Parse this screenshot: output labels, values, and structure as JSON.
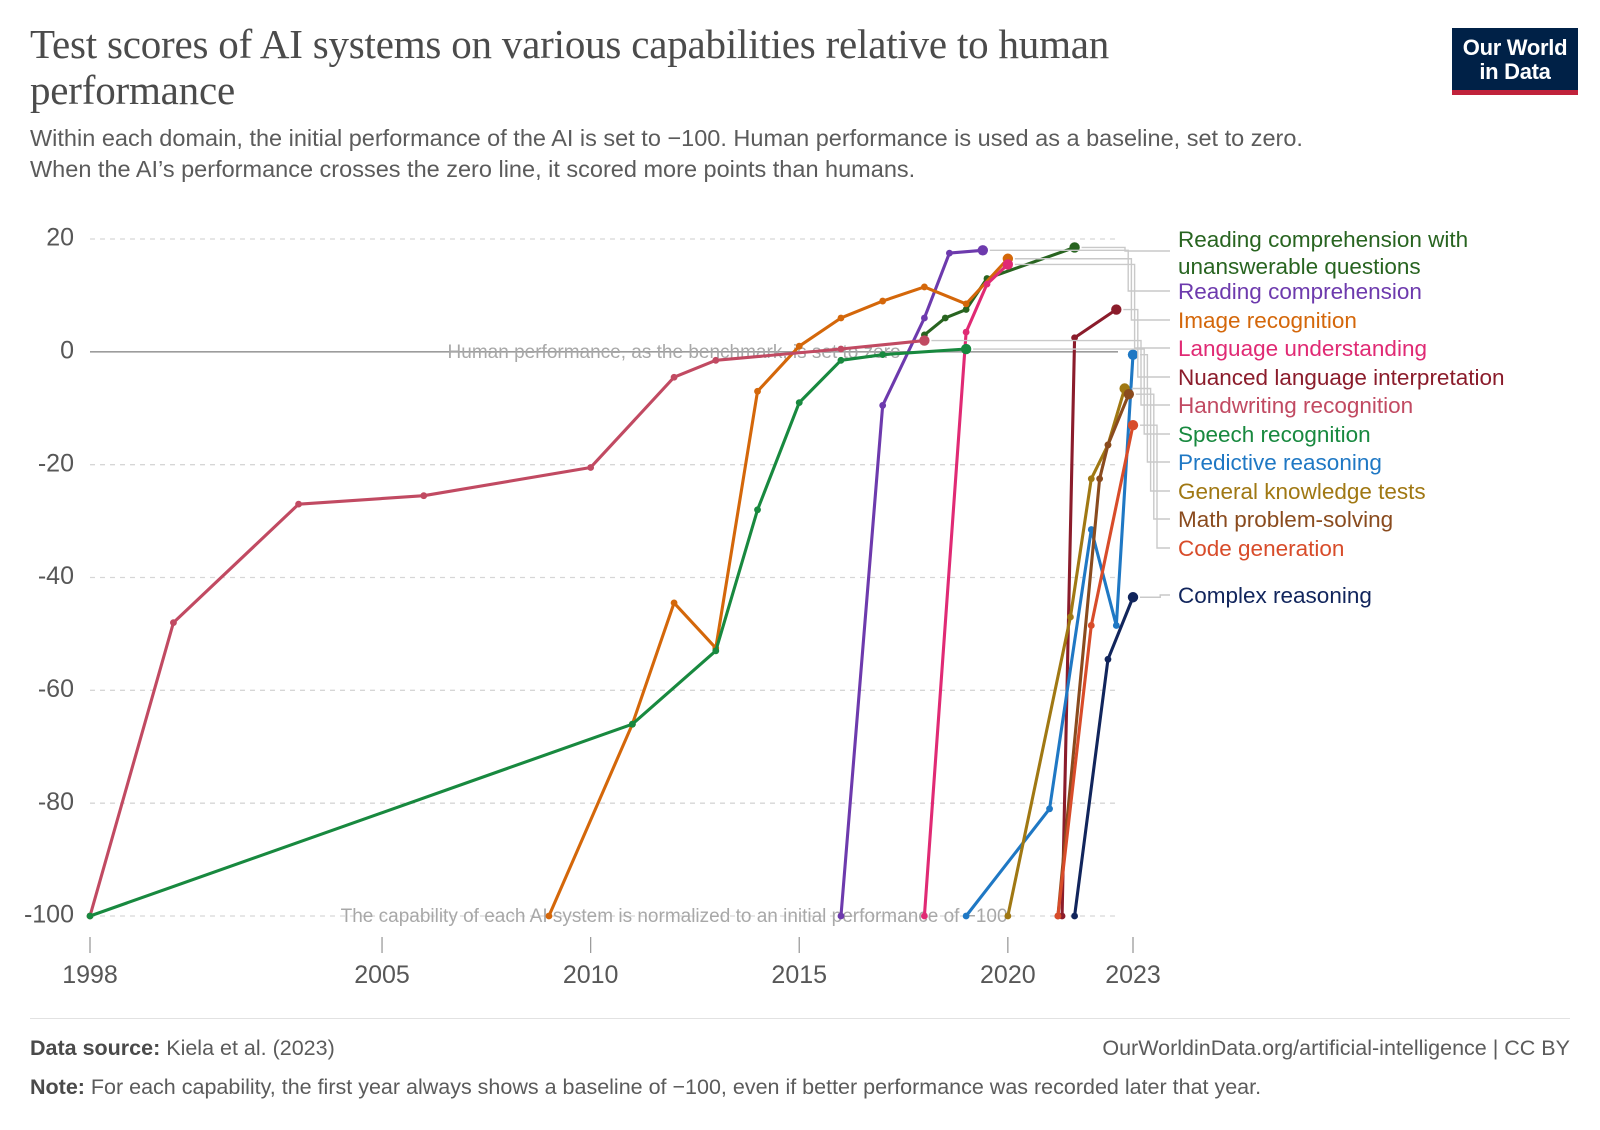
{
  "header": {
    "title": "Test scores of AI systems on various capabilities relative to human performance",
    "subtitle": "Within each domain, the initial performance of the AI is set to −100. Human performance is used as a baseline, set to zero. When the AI’s performance crosses the zero line, it scored more points than humans."
  },
  "logo": {
    "line1": "Our World",
    "line2": "in Data",
    "bg": "#002147",
    "bar": "#c0223b"
  },
  "footer": {
    "source_label": "Data source:",
    "source_value": "Kiela et al. (2023)",
    "url": "OurWorldinData.org/artificial-intelligence | CC BY",
    "note_label": "Note:",
    "note_value": "For each capability, the first year always shows a baseline of −100, even if better performance was recorded later that year."
  },
  "chart_data": {
    "type": "line",
    "title": "Test scores of AI systems on various capabilities relative to human performance",
    "xlabel": "",
    "ylabel": "",
    "xlim": [
      1997,
      2024.2
    ],
    "ylim": [
      -103,
      22
    ],
    "grid": true,
    "legend_position": "right",
    "x_ticks": [
      "1998",
      "2005",
      "2010",
      "2015",
      "2020",
      "2023"
    ],
    "x_tick_values": [
      1998,
      2005,
      2010,
      2015,
      2020,
      2023
    ],
    "y_ticks": [
      "20",
      "0",
      "-20",
      "-40",
      "-60",
      "-80",
      "-100"
    ],
    "y_tick_values": [
      20,
      0,
      -20,
      -40,
      -60,
      -80,
      -100
    ],
    "annotations": [
      {
        "text": "Human performance, as the benchmark, is set to zero",
        "x": 2012.0,
        "y": 0
      },
      {
        "text": "The capability of each AI system is normalized to an initial performance of −100",
        "x": 2012.0,
        "y": -100
      }
    ],
    "series": [
      {
        "name": "Reading comprehension with unanswerable questions",
        "color": "#286420",
        "x": [
          2018,
          2018.5,
          2019,
          2019.5,
          2021.6
        ],
        "y": [
          3.0,
          6.0,
          7.5,
          13.0,
          18.5
        ]
      },
      {
        "name": "Reading comprehension",
        "color": "#6d3aad",
        "x": [
          2016,
          2017,
          2018,
          2018.6,
          2019.4
        ],
        "y": [
          -100.0,
          -9.5,
          6.0,
          17.5,
          18.0
        ]
      },
      {
        "name": "Image recognition",
        "color": "#d4670a",
        "x": [
          2009,
          2011,
          2012,
          2013,
          2014,
          2015,
          2016,
          2017,
          2018,
          2019,
          2020
        ],
        "y": [
          -100.0,
          -66.0,
          -44.5,
          -52.5,
          -7.0,
          1.0,
          6.0,
          9.0,
          11.5,
          8.5,
          16.5
        ]
      },
      {
        "name": "Language understanding",
        "color": "#e02a74",
        "x": [
          2018,
          2019,
          2019.5,
          2020
        ],
        "y": [
          -100.0,
          3.5,
          12.0,
          15.5
        ]
      },
      {
        "name": "Nuanced language interpretation",
        "color": "#8b1c2b",
        "x": [
          2021.3,
          2021.6,
          2022.6
        ],
        "y": [
          -100.0,
          2.5,
          7.5
        ]
      },
      {
        "name": "Handwriting recognition",
        "color": "#c14a62",
        "x": [
          1998,
          2000,
          2003,
          2006,
          2010,
          2012,
          2013,
          2016,
          2018
        ],
        "y": [
          -100.0,
          -48.0,
          -27.0,
          -25.5,
          -20.5,
          -4.5,
          -1.5,
          0.5,
          2.0
        ]
      },
      {
        "name": "Speech recognition",
        "color": "#18893f",
        "x": [
          1998,
          2011,
          2013,
          2014,
          2015,
          2016,
          2017,
          2019
        ],
        "y": [
          -100.0,
          -66.0,
          -53.0,
          -28.0,
          -9.0,
          -1.5,
          -0.5,
          0.5
        ]
      },
      {
        "name": "Predictive reasoning",
        "color": "#1f78c4",
        "x": [
          2019,
          2021,
          2022,
          2022.6,
          2023
        ],
        "y": [
          -100.0,
          -81.0,
          -31.5,
          -48.5,
          -0.5
        ]
      },
      {
        "name": "General knowledge tests",
        "color": "#a07813",
        "x": [
          2020,
          2021.5,
          2022,
          2022.4,
          2022.8
        ],
        "y": [
          -100.0,
          -47.0,
          -22.5,
          -16.5,
          -6.5
        ]
      },
      {
        "name": "Math problem-solving",
        "color": "#8a4b1e",
        "x": [
          2021.2,
          2022.2,
          2022.4,
          2022.9
        ],
        "y": [
          -100.0,
          -22.5,
          -16.5,
          -7.5
        ]
      },
      {
        "name": "Code generation",
        "color": "#d84c2a",
        "x": [
          2021.2,
          2022,
          2023
        ],
        "y": [
          -100.0,
          -48.5,
          -13.0
        ]
      },
      {
        "name": "Complex reasoning",
        "color": "#11255c",
        "x": [
          2021.6,
          2022.4,
          2023
        ],
        "y": [
          -100.0,
          -54.5,
          -43.5
        ]
      }
    ],
    "legend": [
      {
        "label": "Reading comprehension with unanswerable questions",
        "color": "#286420",
        "wrap": true
      },
      {
        "label": "Reading comprehension",
        "color": "#6d3aad",
        "wrap": false
      },
      {
        "label": "Image recognition",
        "color": "#d4670a",
        "wrap": false
      },
      {
        "label": "Language understanding",
        "color": "#e02a74",
        "wrap": false
      },
      {
        "label": "Nuanced language interpretation",
        "color": "#8b1c2b",
        "wrap": false
      },
      {
        "label": "Handwriting recognition",
        "color": "#c14a62",
        "wrap": false
      },
      {
        "label": "Speech recognition",
        "color": "#18893f",
        "wrap": false
      },
      {
        "label": "Predictive reasoning",
        "color": "#1f78c4",
        "wrap": false
      },
      {
        "label": "General knowledge tests",
        "color": "#a07813",
        "wrap": false
      },
      {
        "label": "Math problem-solving",
        "color": "#8a4b1e",
        "wrap": false
      },
      {
        "label": "Code generation",
        "color": "#d84c2a",
        "wrap": false
      },
      {
        "label": "Complex reasoning",
        "color": "#11255c",
        "wrap": false
      }
    ]
  }
}
